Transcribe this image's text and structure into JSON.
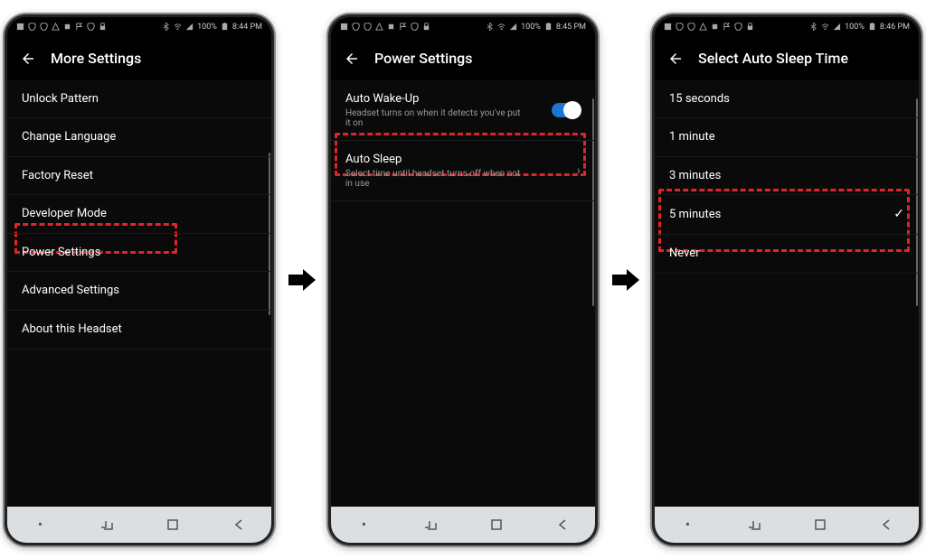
{
  "status": {
    "battery": "100%",
    "time1": "8:44 PM",
    "time2": "8:45 PM",
    "time3": "8:46 PM"
  },
  "phone1": {
    "title": "More Settings",
    "items": [
      {
        "label": "Unlock Pattern"
      },
      {
        "label": "Change Language"
      },
      {
        "label": "Factory Reset"
      },
      {
        "label": "Developer Mode"
      },
      {
        "label": "Power Settings"
      },
      {
        "label": "Advanced Settings"
      },
      {
        "label": "About this Headset"
      }
    ]
  },
  "phone2": {
    "title": "Power Settings",
    "items": [
      {
        "label": "Auto Wake-Up",
        "desc": "Headset turns on when it detects you've put it on",
        "toggle": true
      },
      {
        "label": "Auto Sleep",
        "desc": "Select time until headset turns off when not in use",
        "chevron": true
      }
    ]
  },
  "phone3": {
    "title": "Select Auto Sleep Time",
    "items": [
      {
        "label": "15 seconds"
      },
      {
        "label": "1 minute"
      },
      {
        "label": "3 minutes"
      },
      {
        "label": "5 minutes",
        "selected": true
      },
      {
        "label": "Never"
      }
    ]
  }
}
